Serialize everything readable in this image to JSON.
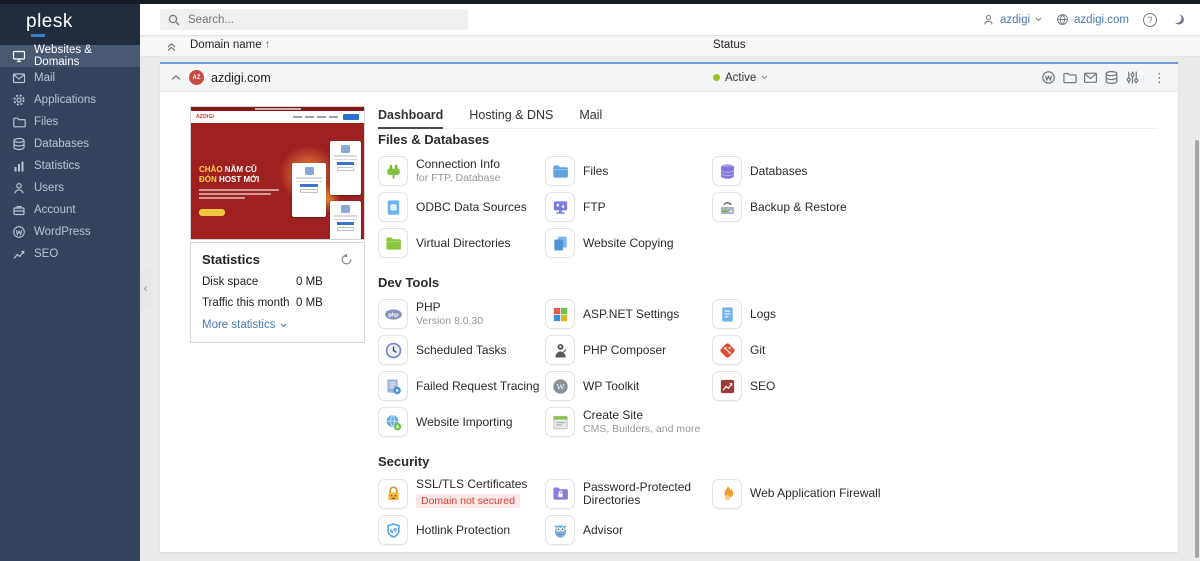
{
  "colors": {
    "accent_blue": "#4779b3",
    "status_green": "#9ac22a",
    "sidebar_bg": "#35445c",
    "sidebar_active_bg": "#4a5972",
    "card_top_border": "#6f9bd0",
    "danger_red": "#cf4436"
  },
  "sidebar": {
    "logo": "plesk",
    "items": [
      {
        "label": "Websites & Domains",
        "icon": "monitor-icon",
        "active": true
      },
      {
        "label": "Mail",
        "icon": "mail-icon"
      },
      {
        "label": "Applications",
        "icon": "gear-icon"
      },
      {
        "label": "Files",
        "icon": "folder-icon"
      },
      {
        "label": "Databases",
        "icon": "database-icon"
      },
      {
        "label": "Statistics",
        "icon": "bar-chart-icon"
      },
      {
        "label": "Users",
        "icon": "user-icon"
      },
      {
        "label": "Account",
        "icon": "briefcase-icon"
      },
      {
        "label": "WordPress",
        "icon": "wordpress-icon"
      },
      {
        "label": "SEO",
        "icon": "seo-chart-icon"
      }
    ]
  },
  "topbar": {
    "search_placeholder": "Search...",
    "user_label": "azdigi",
    "site_label": "azdigi.com",
    "help_glyph": "?"
  },
  "list_header": {
    "domain_label": "Domain name",
    "sort_glyph": "↑",
    "status_label": "Status"
  },
  "domain_card": {
    "favicon_text": "AZ",
    "domain": "azdigi.com",
    "status": "Active"
  },
  "preview": {
    "logo": "AZDIGI",
    "headline1_accent": "CHÀO",
    "headline1_rest": "NĂM CŨ",
    "headline2_accent": "ĐÓN",
    "headline2_rest": "HOST MỚI"
  },
  "statistics": {
    "title": "Statistics",
    "rows": [
      {
        "label": "Disk space",
        "value": "0 MB"
      },
      {
        "label": "Traffic this month",
        "value": "0 MB"
      }
    ],
    "more_label": "More statistics"
  },
  "tabs": [
    {
      "label": "Dashboard",
      "active": true
    },
    {
      "label": "Hosting & DNS"
    },
    {
      "label": "Mail"
    }
  ],
  "sections": [
    {
      "title": "Files & Databases",
      "tools": [
        {
          "label": "Connection Info",
          "sublabel": "for FTP, Database",
          "icon": "plug-icon"
        },
        {
          "label": "Files",
          "icon": "folder-blue-icon"
        },
        {
          "label": "Databases",
          "icon": "database-purple-icon"
        },
        {
          "label": "ODBC Data Sources",
          "icon": "odbc-document-icon"
        },
        {
          "label": "FTP",
          "icon": "ftp-monitor-icon"
        },
        {
          "label": "Backup & Restore",
          "icon": "backup-device-icon"
        },
        {
          "label": "Virtual Directories",
          "icon": "folder-green-icon"
        },
        {
          "label": "Website Copying",
          "icon": "copy-pages-icon"
        }
      ]
    },
    {
      "title": "Dev Tools",
      "tools": [
        {
          "label": "PHP",
          "sublabel": "Version 8.0.30",
          "icon": "php-icon",
          "icon_text": "php"
        },
        {
          "label": "ASP.NET Settings",
          "icon": "aspnet-squares-icon"
        },
        {
          "label": "Logs",
          "icon": "logs-document-icon"
        },
        {
          "label": "Scheduled Tasks",
          "icon": "clock-icon"
        },
        {
          "label": "PHP Composer",
          "icon": "composer-icon"
        },
        {
          "label": "Git",
          "icon": "git-icon"
        },
        {
          "label": "Failed Request Tracing",
          "icon": "request-tracing-icon"
        },
        {
          "label": "WP Toolkit",
          "icon": "wp-toolkit-icon",
          "icon_text": "W"
        },
        {
          "label": "SEO",
          "icon": "seo-tool-icon"
        },
        {
          "label": "Website Importing",
          "icon": "globe-import-icon"
        },
        {
          "label": "Create Site",
          "sublabel": "CMS, Builders, and more",
          "icon": "create-site-icon"
        }
      ]
    },
    {
      "title": "Security",
      "tools": [
        {
          "label": "SSL/TLS Certificates",
          "badge": "Domain not secured",
          "icon": "ssl-lock-icon"
        },
        {
          "label": "Password-Protected Directories",
          "icon": "protected-folder-icon"
        },
        {
          "label": "Web Application Firewall",
          "icon": "firewall-flame-icon"
        },
        {
          "label": "Hotlink Protection",
          "icon": "shield-link-icon"
        },
        {
          "label": "Advisor",
          "icon": "advisor-owl-icon"
        }
      ]
    }
  ],
  "glyphs": {
    "kebab": "⋮",
    "collapse_handle": "‹",
    "wp": "W"
  }
}
